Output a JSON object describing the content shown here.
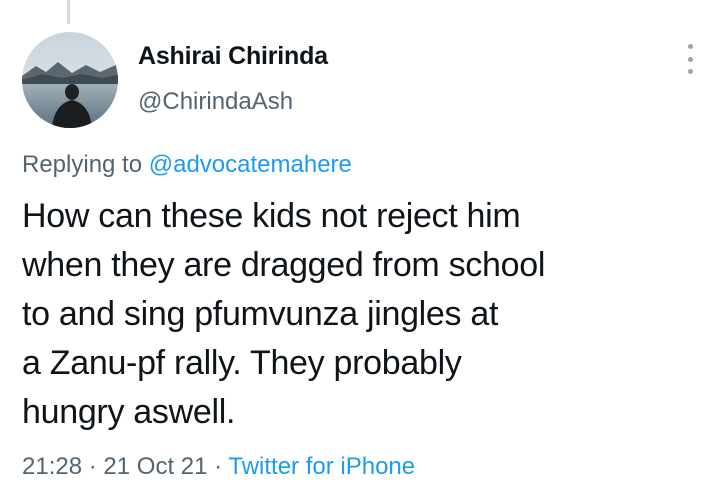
{
  "author": {
    "name": "Ashirai Chirinda",
    "handle": "@ChirindaAsh",
    "avatar_icon": "profile-photo-silhouette-lake"
  },
  "reply": {
    "prefix": "Replying to",
    "mention": "@advocatemahere"
  },
  "tweet": {
    "lines": [
      "How can these kids not reject him",
      "when they are dragged from school",
      "to and sing pfumvunza jingles at",
      "a Zanu-pf rally. They probably",
      "hungry aswell."
    ]
  },
  "meta": {
    "time": "21:28",
    "date": "21 Oct 21",
    "source": "Twitter for iPhone",
    "separator": "·"
  },
  "colors": {
    "text": "#0f1419",
    "secondary": "#536471",
    "link": "#1d9bf0"
  },
  "icons": {
    "more": "more-vertical-icon"
  }
}
